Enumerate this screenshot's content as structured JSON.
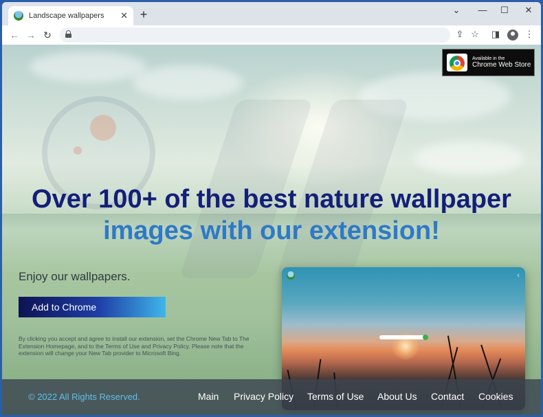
{
  "browser": {
    "tab_title": "Landscape wallpapers",
    "tab_close": "✕",
    "new_tab": "+",
    "win_min": "⌄",
    "win_dash": "—",
    "win_max": "☐",
    "win_close": "✕",
    "back": "←",
    "forward": "→",
    "reload": "↻",
    "share": "⇪",
    "star": "☆",
    "sidepanel": "◨",
    "menu": "⋮"
  },
  "page": {
    "store_badge": {
      "small": "Available in the",
      "big": "Chrome Web Store"
    },
    "headline_line1": "Over 100+ of the best nature wallpaper",
    "headline_line2": "images with our extension!",
    "subtitle": "Enjoy our wallpapers.",
    "cta_label": "Add to Chrome",
    "disclaimer": "By clicking you accept and agree to install our extension, set the Chrome New Tab to The Extension Homepage, and to the Terms of Use and Privacy Policy. Please note that the extension will change your New Tab provider to Microsoft Bing.",
    "preview_arrow": "‹"
  },
  "footer": {
    "copyright": "© 2022 All Rights Reserved.",
    "links": [
      "Main",
      "Privacy Policy",
      "Terms of Use",
      "About Us",
      "Contact",
      "Cookies"
    ]
  },
  "colors": {
    "headline_dark": "#141f78",
    "headline_light": "#2f79c6",
    "copyright": "#5cc0ef",
    "cta_start": "#0e1252",
    "cta_end": "#3fb6ea"
  }
}
